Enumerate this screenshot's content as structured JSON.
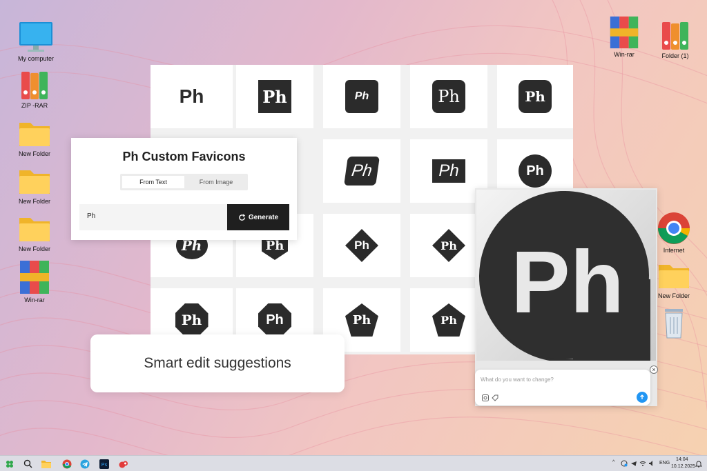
{
  "desktop": {
    "left_icons": [
      {
        "label": "My computer",
        "icon": "monitor-icon"
      },
      {
        "label": "ZIP -RAR",
        "icon": "archive-binders-icon"
      },
      {
        "label": "New Folder",
        "icon": "folder-icon"
      },
      {
        "label": "New Folder",
        "icon": "folder-icon"
      },
      {
        "label": "New Folder",
        "icon": "folder-icon"
      },
      {
        "label": "Win-rar",
        "icon": "winrar-books-icon"
      }
    ],
    "right_icons": [
      {
        "label": "Win-rar",
        "icon": "winrar-books-icon"
      },
      {
        "label": "Folder (1)",
        "icon": "archive-binders-icon"
      },
      {
        "label": "Internet",
        "icon": "chrome-icon"
      },
      {
        "label": "New Folder",
        "icon": "folder-icon"
      },
      {
        "label": "",
        "icon": "recycle-bin-icon"
      }
    ]
  },
  "favicon_grid": {
    "text": "Ph",
    "background": "#333333",
    "foreground": "#ffffff"
  },
  "favicons_panel": {
    "title": "Ph Custom Favicons",
    "tabs": [
      {
        "label": "From Text",
        "active": true
      },
      {
        "label": "From Image",
        "active": false
      }
    ],
    "input_value": "Ph",
    "generate_label": "Generate"
  },
  "smart_edit": {
    "label": "Smart edit suggestions"
  },
  "preview": {
    "logo_text": "Ph",
    "prompt_placeholder": "What do you want to change?"
  },
  "taskbar": {
    "tray": {
      "language": "ENG",
      "time": "14:04",
      "date": "10.12.2025"
    }
  }
}
